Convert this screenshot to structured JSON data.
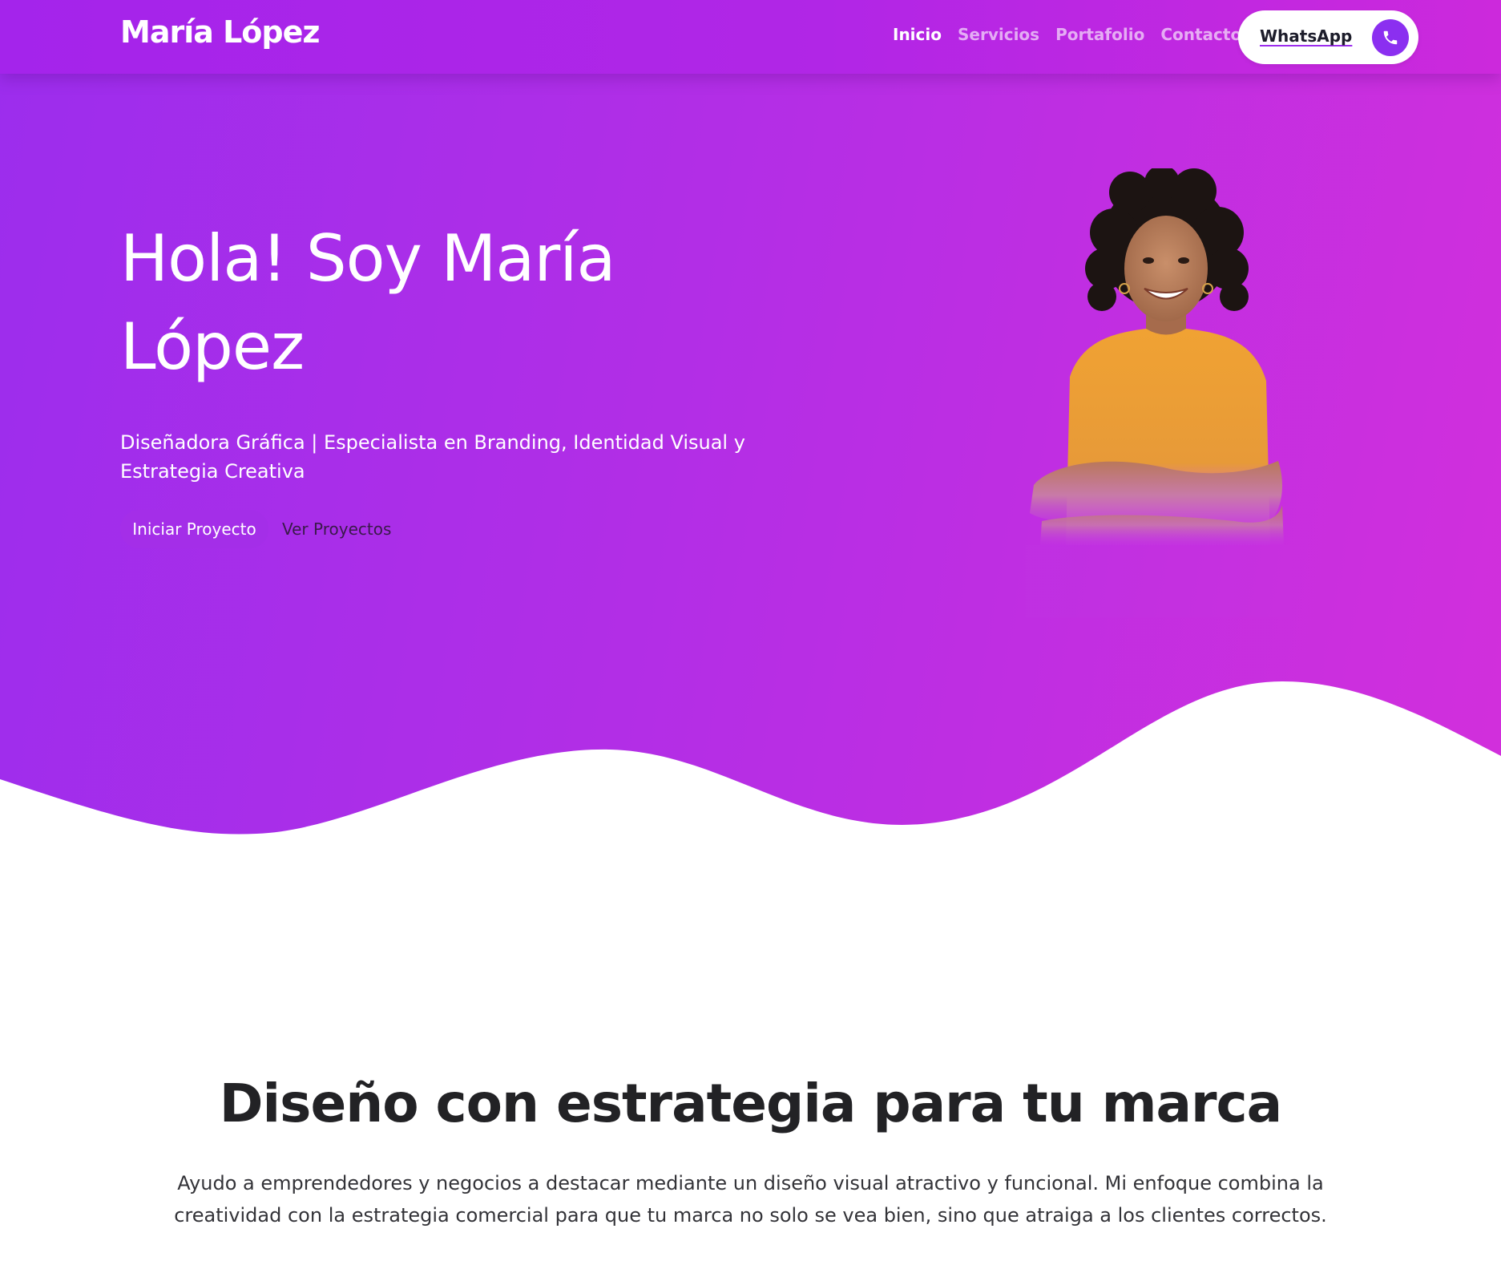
{
  "navbar": {
    "brand": "María López",
    "links": [
      {
        "label": "Inicio",
        "active": true
      },
      {
        "label": "Servicios",
        "active": false
      },
      {
        "label": "Portafolio",
        "active": false
      },
      {
        "label": "Contacto",
        "active": false
      }
    ],
    "whatsapp_label": "WhatsApp",
    "whatsapp_icon": "phone-icon"
  },
  "hero": {
    "title_line1": "Hola! Soy María",
    "title_line2": "López",
    "subtitle": "Diseñadora Gráfica | Especialista en Branding, Identidad Visual y Estrategia Creativa",
    "primary_button": "Iniciar Proyecto",
    "secondary_button": "Ver Proyectos",
    "portrait": "woman-smiling-arms-crossed"
  },
  "intro": {
    "title": "Diseño con estrategia para tu marca",
    "text": "Ayudo a emprendedores y negocios a destacar mediante un diseño visual atractivo y funcional. Mi enfoque combina la creatividad con la estrategia comercial para que tu marca no solo se vea bien, sino que atraiga a los clientes correctos."
  },
  "colors": {
    "gradient_start": "#9c2ded",
    "gradient_end": "#d22fdc",
    "accent": "#8b2ff0",
    "heading": "#222225"
  }
}
